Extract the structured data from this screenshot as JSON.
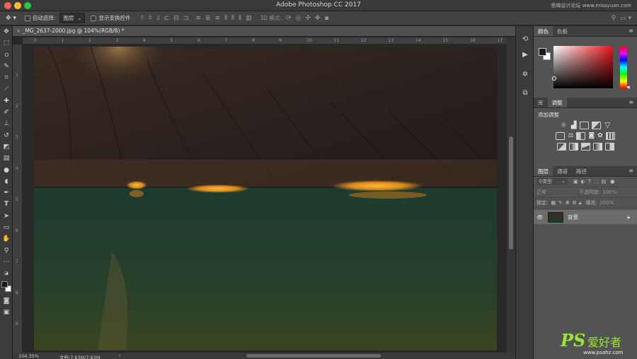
{
  "window": {
    "title": "Adobe Photoshop CC 2017",
    "watermark_top": "思缘设计论坛 www.missyuan.com"
  },
  "options": {
    "auto_select_label": "自动选择:",
    "auto_select_value": "图层",
    "show_transform_label": "显示变换控件",
    "mode_3d_label": "3D 模式:"
  },
  "document": {
    "tab_title": "_MG_2637-2000.jpg @ 104%(RGB/8) *",
    "ruler_numbers": [
      "0",
      "1",
      "2",
      "3",
      "4",
      "5",
      "6",
      "7",
      "8",
      "9",
      "10",
      "11",
      "12",
      "13",
      "14",
      "15",
      "16",
      "17"
    ],
    "vruler_numbers": [
      "1",
      "2",
      "3",
      "4",
      "5",
      "6",
      "7",
      "8",
      "9"
    ]
  },
  "status": {
    "zoom": "104.35%",
    "doc_size": "文档:7.63M/7.63M"
  },
  "panels": {
    "color_tabs": [
      "颜色",
      "色板"
    ],
    "adjust_tabs": [
      "库",
      "调整"
    ],
    "adjust_heading": "添加调整",
    "layers_tabs": [
      "图层",
      "通道",
      "路径"
    ],
    "filter_kind": "类型",
    "blend_mode": "正常",
    "opacity_label": "不透明度:",
    "opacity_value": "100%",
    "lock_label": "锁定:",
    "fill_label": "填充:",
    "fill_value": "100%",
    "layer_name": "背景"
  },
  "watermark": {
    "brand": "PS",
    "cn": "爱好者",
    "url": "www.psahz.com"
  },
  "colors": {
    "foreground": "#1a1a1a",
    "background": "#ffffff",
    "picker_hue": "#e8151b"
  }
}
